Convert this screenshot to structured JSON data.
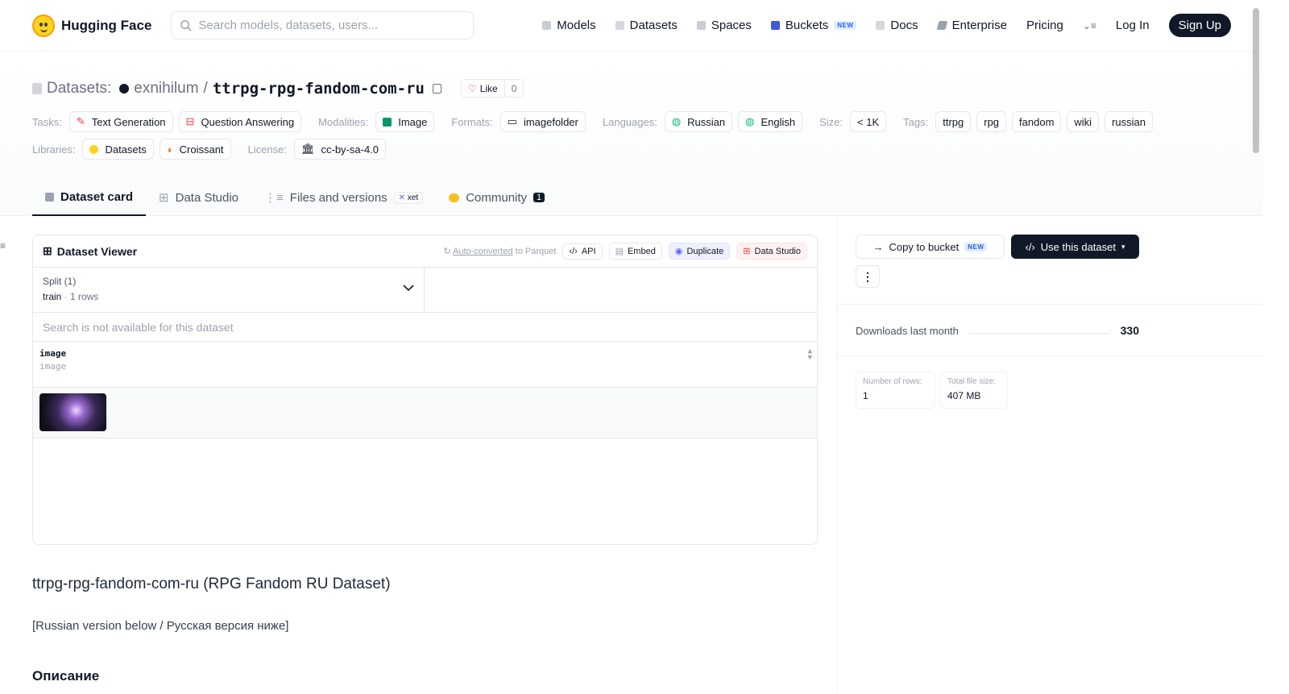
{
  "nav": {
    "brand": "Hugging Face",
    "search_placeholder": "Search models, datasets, users...",
    "links": [
      {
        "label": "Models",
        "color": "#9ca3af"
      },
      {
        "label": "Datasets",
        "color": "#9ca3af"
      },
      {
        "label": "Spaces",
        "color": "#9ca3af"
      },
      {
        "label": "Buckets",
        "color": "#3b5bdb",
        "badge": "NEW"
      },
      {
        "label": "Docs",
        "color": "#9ca3af"
      },
      {
        "label": "Enterprise",
        "color": "#6b7280"
      },
      {
        "label": "Pricing"
      }
    ],
    "login": "Log In",
    "signup": "Sign Up"
  },
  "repo": {
    "section": "Datasets:",
    "owner": "exnihilum",
    "sep": "/",
    "name": "ttrpg-rpg-fandom-com-ru",
    "like_label": "Like",
    "like_count": "0"
  },
  "meta": {
    "tasks_label": "Tasks:",
    "tasks": [
      "Text Generation",
      "Question Answering"
    ],
    "modalities_label": "Modalities:",
    "modalities": [
      "Image"
    ],
    "formats_label": "Formats:",
    "formats": [
      "imagefolder"
    ],
    "languages_label": "Languages:",
    "languages": [
      "Russian",
      "English"
    ],
    "size_label": "Size:",
    "size": "< 1K",
    "tags_label": "Tags:",
    "tags": [
      "ttrpg",
      "rpg",
      "fandom",
      "wiki",
      "russian"
    ],
    "libraries_label": "Libraries:",
    "libraries": [
      "Datasets",
      "Croissant"
    ],
    "license_label": "License:",
    "license": "cc-by-sa-4.0"
  },
  "tabs": [
    {
      "label": "Dataset card"
    },
    {
      "label": "Data Studio"
    },
    {
      "label": "Files and versions",
      "badge": "xet"
    },
    {
      "label": "Community",
      "badge": "1"
    }
  ],
  "viewer": {
    "title": "Dataset Viewer",
    "auto_converted": "Auto-converted",
    "to_parquet": "to Parquet",
    "actions": [
      "API",
      "Embed",
      "Duplicate",
      "Data Studio"
    ],
    "split_label": "Split (1)",
    "split_name": "train",
    "split_rows": "1 rows",
    "search_text": "Search is not available for this dataset",
    "column_name": "image",
    "column_type": "image"
  },
  "readme": {
    "heading": "ttrpg-rpg-fandom-com-ru (RPG Fandom RU Dataset)",
    "note": "[Russian version below / Русская версия ниже]",
    "subheading": "Описание"
  },
  "sidebar": {
    "copy_label": "Copy to bucket",
    "copy_badge": "NEW",
    "use_label": "Use this dataset",
    "more": "⋮",
    "downloads_label": "Downloads last month",
    "downloads_value": "330",
    "rows_label": "Number of rows:",
    "rows_value": "1",
    "size_label": "Total file size:",
    "size_value": "407 MB"
  }
}
